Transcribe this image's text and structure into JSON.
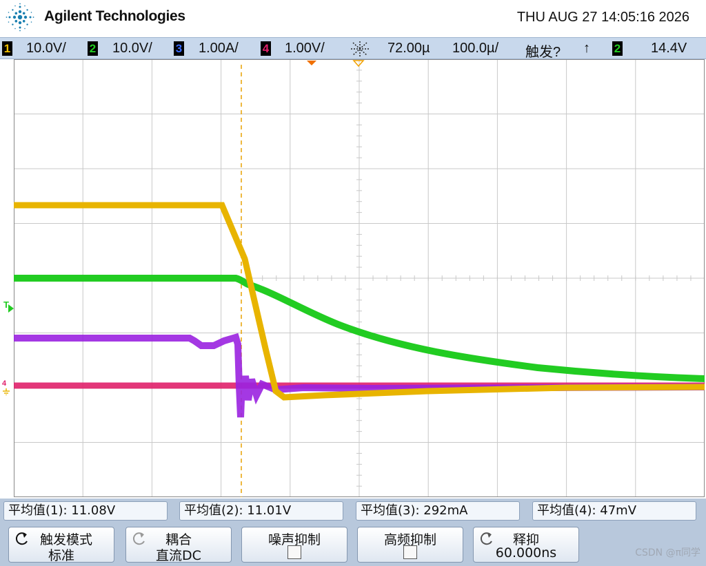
{
  "header": {
    "brand": "Agilent Technologies",
    "datetime": "THU AUG 27 14:05:16 2026"
  },
  "status": {
    "ch1": {
      "num": "1",
      "scale": "10.0V/",
      "color": "#f0c000"
    },
    "ch2": {
      "num": "2",
      "scale": "10.0V/",
      "color": "#22cc22"
    },
    "ch3": {
      "num": "3",
      "scale": "1.00A/",
      "color": "#3b6cff"
    },
    "ch4": {
      "num": "4",
      "scale": "1.00V/",
      "color": "#e0206a"
    },
    "time_delay": "72.00µ",
    "time_scale": "100.0µ/",
    "trigger_state": "触发?",
    "trigger_edge": "↑",
    "trigger_source": "2",
    "trigger_level": "14.4V"
  },
  "marks": {
    "trigger_marker": "T",
    "ground_marker": "4"
  },
  "measurements": [
    {
      "label": "平均值(1): 11.08V"
    },
    {
      "label": "平均值(2): 11.01V"
    },
    {
      "label": "平均值(3): 292mA"
    },
    {
      "label": "平均值(4): 47mV"
    }
  ],
  "softkeys": [
    {
      "line1": "触发模式",
      "line2": "标准",
      "icon": "rotate-icon"
    },
    {
      "line1": "耦合",
      "line2": "直流DC",
      "icon": "rotate-icon"
    },
    {
      "line1": "噪声抑制",
      "line2": "",
      "icon": "checkbox"
    },
    {
      "line1": "高频抑制",
      "line2": "",
      "icon": "checkbox"
    },
    {
      "line1": "释抑",
      "line2": "60.000ns",
      "icon": "rotate-icon"
    }
  ],
  "watermark": "CSDN @π同学",
  "colors": {
    "grid": "#c8c8c8",
    "trace_yellow": "#e8b400",
    "trace_green": "#22cc22",
    "trace_purple": "#9a22e0",
    "trace_pink": "#e0206a",
    "cursor": "#e8a000"
  }
}
